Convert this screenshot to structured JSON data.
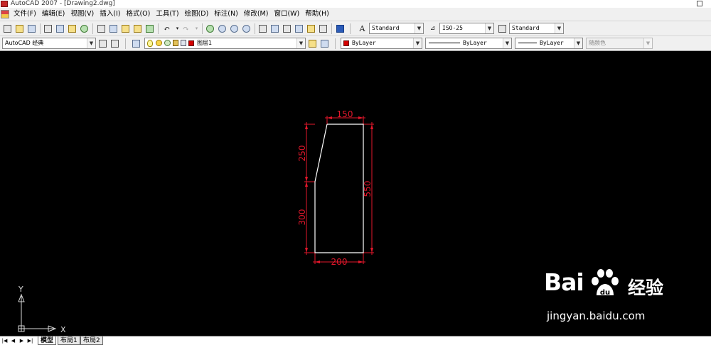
{
  "window": {
    "title": "AutoCAD 2007 - [Drawing2.dwg]"
  },
  "menu": {
    "items": [
      "文件(F)",
      "编辑(E)",
      "视图(V)",
      "插入(I)",
      "格式(O)",
      "工具(T)",
      "绘图(D)",
      "标注(N)",
      "修改(M)",
      "窗口(W)",
      "帮助(H)"
    ]
  },
  "styles_toolbar": {
    "text_style": "Standard",
    "dim_style": "ISO-25",
    "table_style": "Standard"
  },
  "workspace": {
    "value": "AutoCAD 经典"
  },
  "layer": {
    "value": "图层1"
  },
  "properties": {
    "color": "ByLayer",
    "linetype": "ByLayer",
    "lineweight": "ByLayer",
    "plot_style": "随颜色"
  },
  "drawing": {
    "background": "#000000",
    "outline_color": "#ffffff",
    "dim_color": "#e4172b",
    "dimensions": {
      "top_width": "150",
      "bottom_width": "200",
      "upper_height": "250",
      "lower_height": "300",
      "total_height": "550"
    }
  },
  "ucs": {
    "x_label": "X",
    "y_label": "Y"
  },
  "watermark": {
    "logo": "Bai",
    "logo_suffix": "经验",
    "url": "jingyan.baidu.com"
  },
  "tabs": [
    "模型",
    "布局1",
    "布局2"
  ]
}
